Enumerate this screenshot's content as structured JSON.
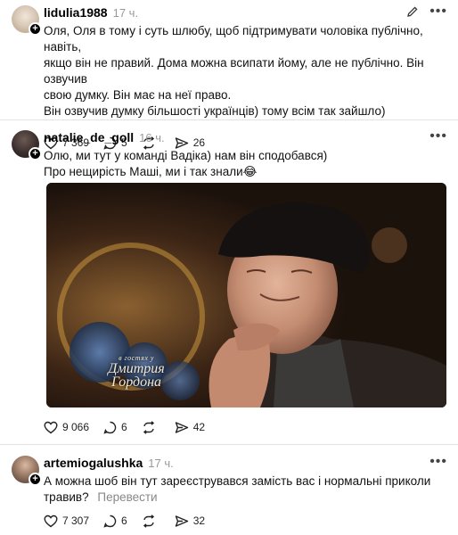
{
  "posts": [
    {
      "username": "lidulia1988",
      "time": "17 ч.",
      "lines": [
        "Оля, Оля в тому і суть шлюбу, щоб підтримувати чоловіка публічно, навіть,",
        "якщо він не правий. Дома можна всипати йому, але не публічно. Він озвучив",
        "свою думку. Він має на неї право.",
        "Він озвучив думку більшості українців) тому всім так зайшло)"
      ],
      "likes": "7 369",
      "comments": "5",
      "shares": "26"
    },
    {
      "username": "natalie_de_goll",
      "time": "16 ч.",
      "lines": [
        "Олю, ми тут у команді Вадіка) нам він сподобався)",
        "Про нещирість Маші, ми і так знали😂"
      ],
      "image_logo_line1": "в гостях у",
      "image_logo_line2": "Дмитрия",
      "image_logo_line3": "Гордона",
      "likes": "9 066",
      "comments": "6",
      "shares": "42"
    },
    {
      "username": "artemiogalushka",
      "time": "17 ч.",
      "lines": [
        "А можна шоб він тут зареєструвався замість вас і нормальні приколи",
        "травив?"
      ],
      "translate": "Перевести",
      "likes": "7 307",
      "comments": "6",
      "shares": "32"
    }
  ],
  "icons": {
    "like": "heart-icon",
    "comment": "comment-icon",
    "repost": "repost-icon",
    "share": "send-icon",
    "more": "more-icon",
    "edit": "edit-icon",
    "follow": "plus-icon"
  }
}
